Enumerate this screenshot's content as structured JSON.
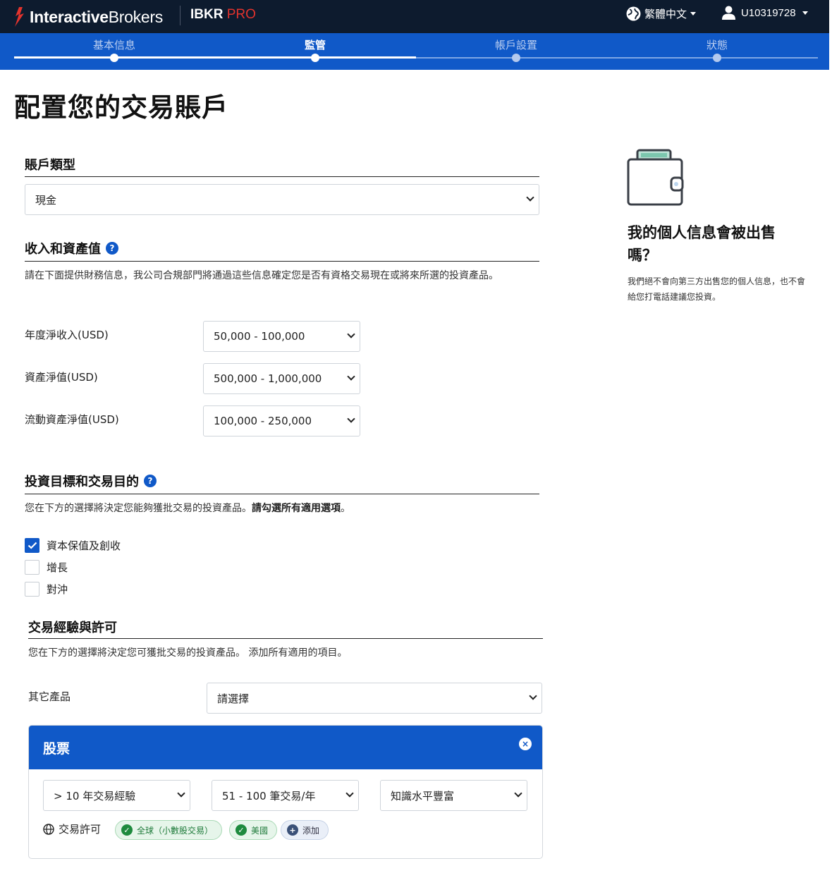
{
  "header": {
    "brand_bold": "Interactive",
    "brand_light": "Brokers",
    "product_name": "IBKR",
    "product_tier": "PRO",
    "language": "繁體中文",
    "account_id": "U10319728"
  },
  "steps": [
    {
      "label": "基本信息",
      "state": "done"
    },
    {
      "label": "監管",
      "state": "active"
    },
    {
      "label": "帳戶設置",
      "state": "pending"
    },
    {
      "label": "狀態",
      "state": "pending"
    }
  ],
  "page_title": "配置您的交易賬戶",
  "account_type": {
    "title": "賬戶類型",
    "value": "現金"
  },
  "income": {
    "title": "收入和資產值",
    "description": "請在下面提供財務信息，我公司合規部門將通過這些信息確定您是否有資格交易現在或將來所選的投資產品。",
    "fields": [
      {
        "label": "年度淨收入(USD)",
        "value": "50,000 - 100,000"
      },
      {
        "label": "資產淨值(USD)",
        "value": "500,000 - 1,000,000"
      },
      {
        "label": "流動資產淨值(USD)",
        "value": "100,000 - 250,000"
      }
    ]
  },
  "objectives": {
    "title": "投資目標和交易目的",
    "description_plain": "您在下方的選擇將決定您能夠獲批交易的投資產品。",
    "description_bold": "請勾選所有適用選項",
    "description_end": "。",
    "options": [
      {
        "label": "資本保值及創收",
        "checked": true
      },
      {
        "label": "增長",
        "checked": false
      },
      {
        "label": "對沖",
        "checked": false
      }
    ]
  },
  "experience": {
    "title": "交易經驗與許可",
    "description": "您在下方的選擇將決定您可獲批交易的投資產品。 添加所有適用的項目。",
    "other_products_label": "其它產品",
    "other_products_value": "請選擇",
    "stocks_panel": {
      "title": "股票",
      "close_icon": "×",
      "years": "> 10 年交易經驗",
      "trades": "51 - 100 筆交易/年",
      "knowledge": "知識水平豐富",
      "permissions_label": "交易許可",
      "chips": [
        "全球（小數股交易）",
        "美國"
      ],
      "add_label": "添加"
    }
  },
  "sidebar": {
    "title": "我的個人信息會被出售嗎？",
    "description": "我們絕不會向第三方出售您的個人信息，也不會給您打電話建議您投資。"
  },
  "colors": {
    "header_bg": "#0d1b2e",
    "primary_blue": "#1059c8",
    "brand_red": "#e2332d",
    "success_green": "#1e8a3e"
  }
}
